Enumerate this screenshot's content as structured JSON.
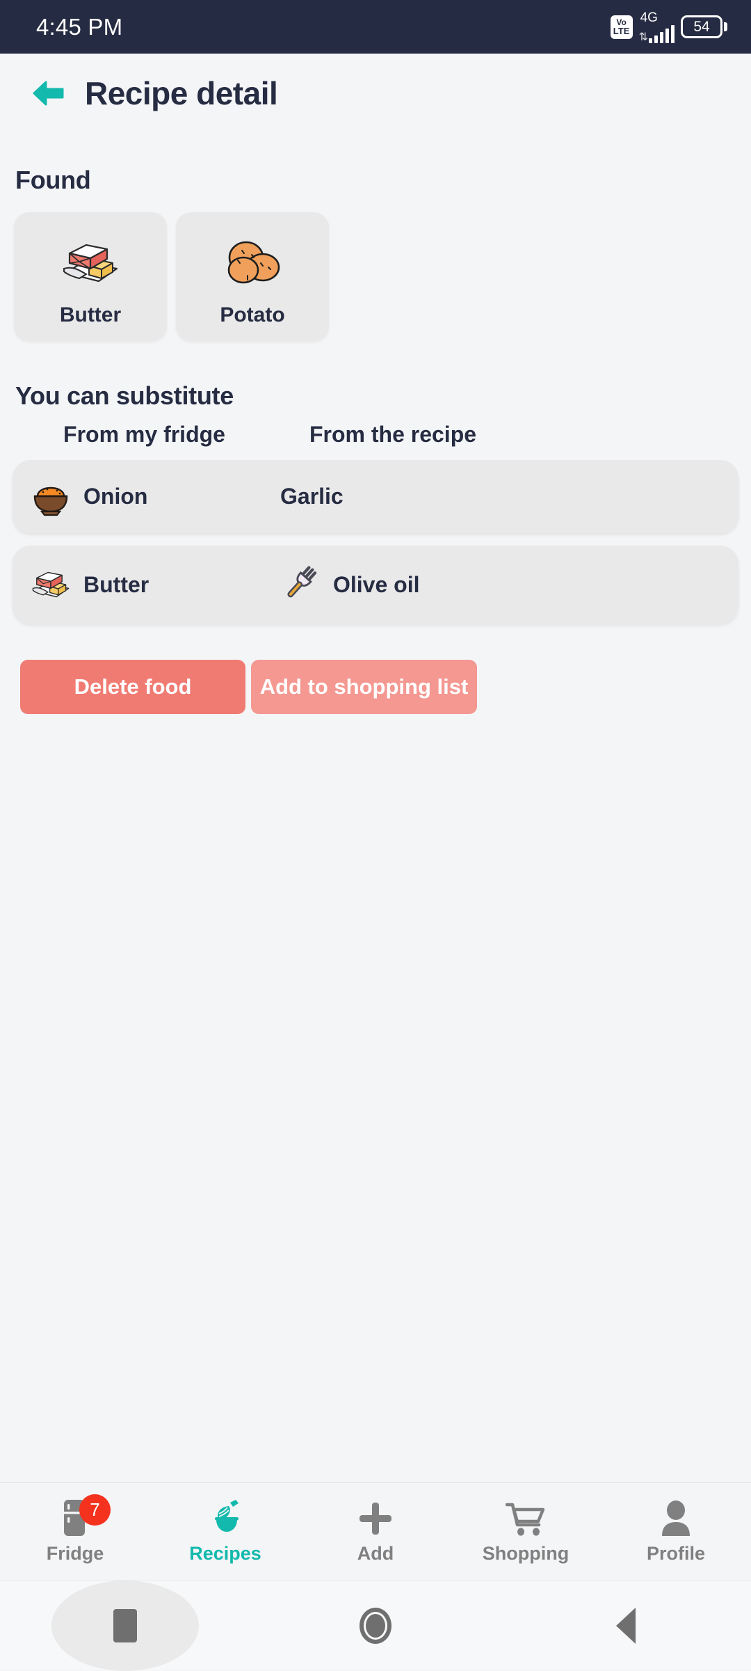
{
  "status_bar": {
    "time": "4:45 PM",
    "volte_top": "Vo",
    "volte_bottom": "LTE",
    "network_label": "4G",
    "data_arrows": "⇅",
    "battery_level": "54",
    "bg_color": "#252B42"
  },
  "header": {
    "back_icon": "back-arrow-icon",
    "title": "Recipe detail",
    "accent_color": "#12B9AC"
  },
  "found": {
    "label": "Found",
    "items": [
      {
        "name": "Butter",
        "icon": "butter-emoji"
      },
      {
        "name": "Potato",
        "icon": "potato-emoji"
      }
    ]
  },
  "substitute": {
    "label": "You can substitute",
    "columns": [
      "From my fridge",
      "From the recipe"
    ],
    "rows": [
      {
        "fridge": "Onion",
        "fridge_icon": "onion-bowl-emoji",
        "recipe": "Garlic",
        "recipe_icon": ""
      },
      {
        "fridge": "Butter",
        "fridge_icon": "butter-emoji",
        "recipe": "Olive oil",
        "recipe_icon": "fork-emoji"
      }
    ]
  },
  "actions": {
    "delete_label": "Delete food",
    "delete_color": "#F07B72",
    "add_label": "Add to shopping list",
    "add_color": "#F49891"
  },
  "bottom_nav": {
    "active_color": "#12B9AC",
    "inactive_color": "#808080",
    "badge_color": "#F4321E",
    "items": [
      {
        "label": "Fridge",
        "icon": "fridge-icon",
        "badge": "7",
        "active": false
      },
      {
        "label": "Recipes",
        "icon": "whisk-bowl-icon",
        "badge": "",
        "active": true
      },
      {
        "label": "Add",
        "icon": "plus-icon",
        "badge": "",
        "active": false
      },
      {
        "label": "Shopping",
        "icon": "cart-icon",
        "badge": "",
        "active": false
      },
      {
        "label": "Profile",
        "icon": "person-icon",
        "badge": "",
        "active": false
      }
    ]
  },
  "system_nav": {
    "recents_icon": "square-recents-icon",
    "home_icon": "circle-home-icon",
    "back_icon": "triangle-back-icon"
  }
}
